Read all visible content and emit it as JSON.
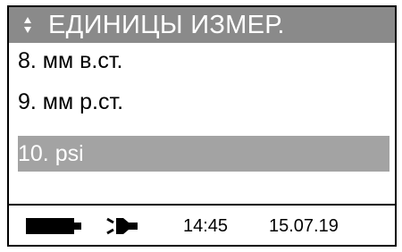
{
  "header": {
    "title": "ЕДИНИЦЫ ИЗМЕР.",
    "icon": "up-down-arrows-icon"
  },
  "menu": {
    "items": [
      {
        "label": "8. мм в.ст.",
        "selected": false
      },
      {
        "label": "9. мм р.ст.",
        "selected": false
      },
      {
        "label": "10. psi",
        "selected": true
      }
    ]
  },
  "status": {
    "battery_icon": "battery-icon",
    "power_icon": "power-plug-icon",
    "time": "14:45",
    "date": "15.07.19"
  },
  "colors": {
    "title_background": "#8a8a8a",
    "selection_background": "#a3a3a3",
    "text": "#000000",
    "inverse_text": "#ffffff"
  }
}
